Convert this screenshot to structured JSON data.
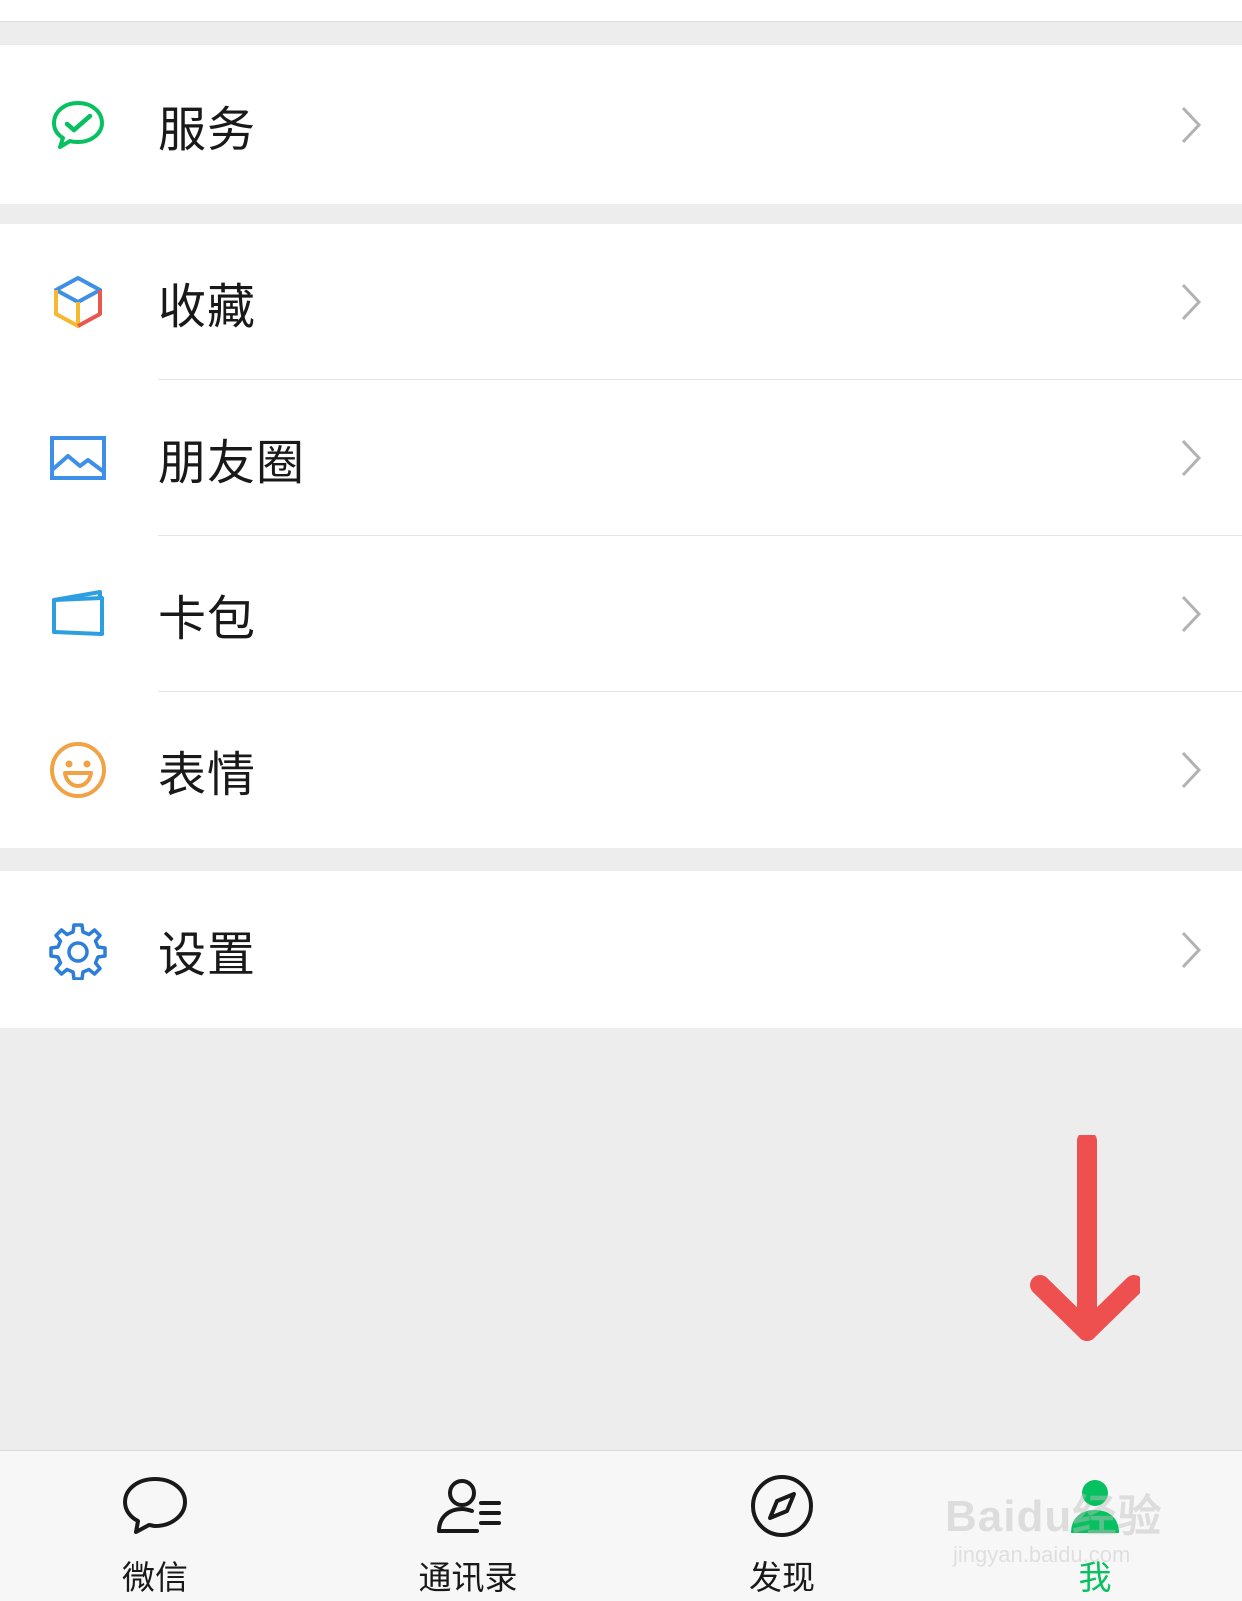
{
  "menu": {
    "services": {
      "label": "服务",
      "icon": "wechat-pay-check-icon"
    },
    "favorites": {
      "label": "收藏",
      "icon": "cube-icon"
    },
    "moments": {
      "label": "朋友圈",
      "icon": "photo-icon"
    },
    "card_wallet": {
      "label": "卡包",
      "icon": "card-icon"
    },
    "stickers": {
      "label": "表情",
      "icon": "smiley-icon"
    },
    "settings": {
      "label": "设置",
      "icon": "gear-icon"
    }
  },
  "tabbar": {
    "tabs": [
      {
        "label": "微信",
        "icon": "chat-bubble-icon",
        "active": false
      },
      {
        "label": "通讯录",
        "icon": "contacts-icon",
        "active": false
      },
      {
        "label": "发现",
        "icon": "compass-icon",
        "active": false
      },
      {
        "label": "我",
        "icon": "person-icon",
        "active": true
      }
    ]
  },
  "watermark": {
    "brand": "Baidu经验",
    "url": "jingyan.baidu.com"
  },
  "colors": {
    "accent": "#07c160",
    "annotation_arrow": "#ee5050",
    "background": "#ededed"
  }
}
